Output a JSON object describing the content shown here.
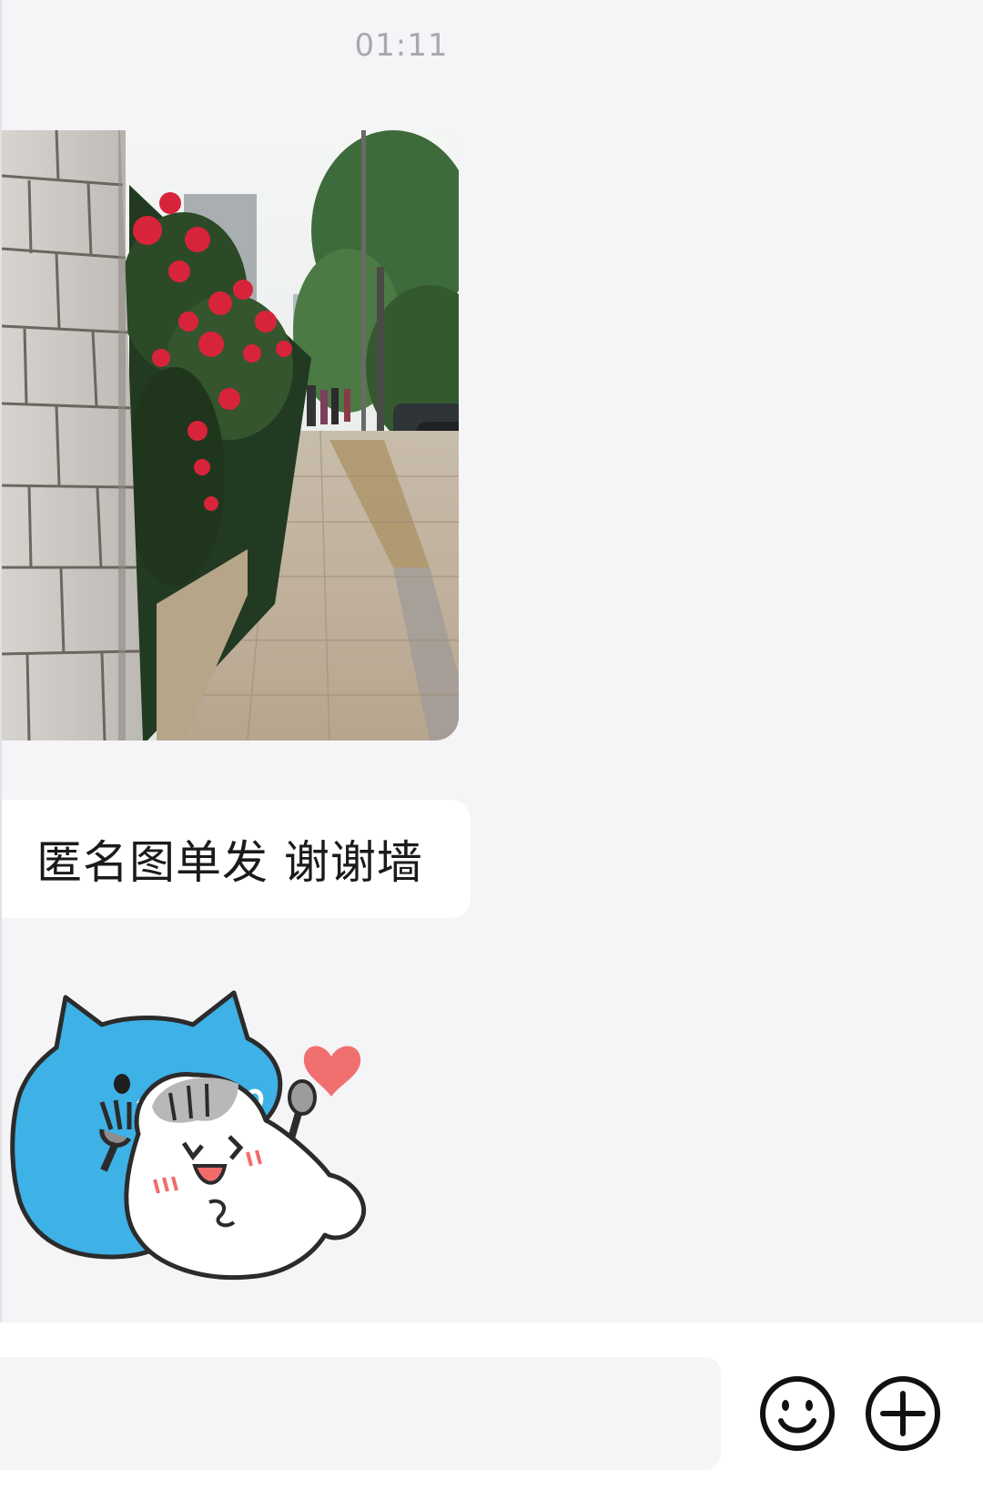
{
  "chat": {
    "timestamp": "01:11",
    "messages": {
      "photo": {
        "type": "image",
        "icon": "street-rose-photo"
      },
      "text": {
        "type": "text",
        "content": "匿名图单发 谢谢墙"
      },
      "sticker": {
        "type": "sticker",
        "icon": "blue-cat-hugging-white-cat-sticker"
      }
    }
  },
  "input_bar": {
    "placeholder": "",
    "value": "",
    "emoji_icon": "smiley-face-icon",
    "more_icon": "plus-circle-icon"
  },
  "colors": {
    "background": "#f5f4f7",
    "bubble": "#ffffff",
    "timestamp": "#a9a8ad",
    "sticker_blue": "#3eb1e6",
    "heart": "#f07070"
  }
}
